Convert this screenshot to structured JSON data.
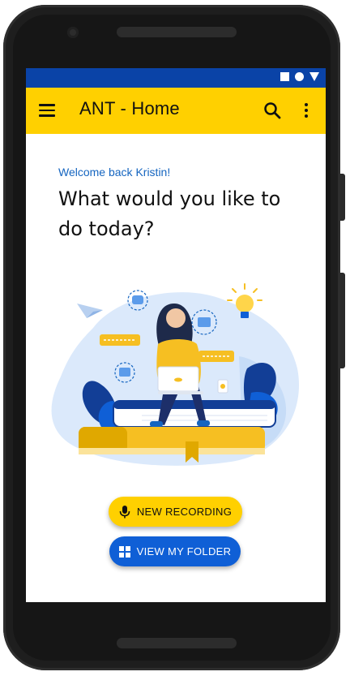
{
  "status_bar": {
    "icons": [
      "square-icon",
      "circle-icon",
      "triangle-icon"
    ]
  },
  "app_bar": {
    "title": "ANT - Home",
    "menu_icon": "hamburger-menu-icon",
    "search_icon": "search-icon",
    "more_icon": "more-vert-icon"
  },
  "content": {
    "welcome": "Welcome back Kristin!",
    "headline": "What would you like to do today?"
  },
  "actions": {
    "new_recording": {
      "label": "NEW RECORDING",
      "icon": "microphone-icon"
    },
    "view_folder": {
      "label": "VIEW MY FOLDER",
      "icon": "grid-icon"
    }
  },
  "colors": {
    "accent_yellow": "#ffd000",
    "primary_blue": "#0f5fd6",
    "status_blue": "#0a43a7",
    "welcome_blue": "#1565c0"
  }
}
